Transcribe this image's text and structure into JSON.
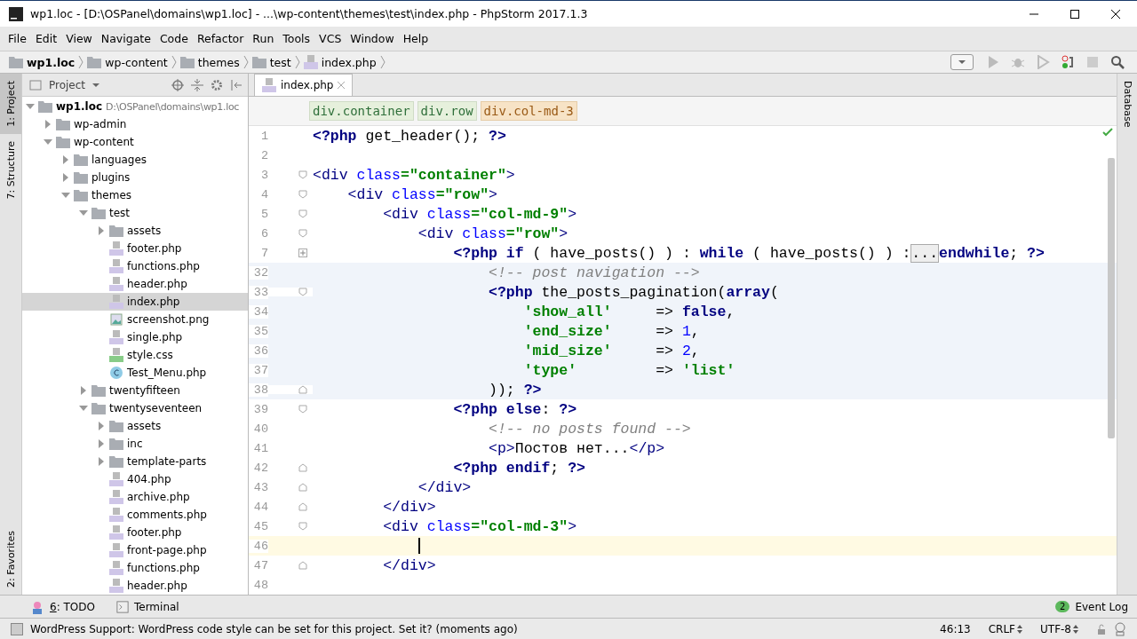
{
  "window": {
    "title": "wp1.loc - [D:\\OSPanel\\domains\\wp1.loc] - ...\\wp-content\\themes\\test\\index.php - PhpStorm 2017.1.3"
  },
  "menu": [
    "File",
    "Edit",
    "View",
    "Navigate",
    "Code",
    "Refactor",
    "Run",
    "Tools",
    "VCS",
    "Window",
    "Help"
  ],
  "nav_bar": [
    {
      "label": "wp1.loc",
      "kind": "root"
    },
    {
      "label": "wp-content",
      "kind": "folder"
    },
    {
      "label": "themes",
      "kind": "folder"
    },
    {
      "label": "test",
      "kind": "folder"
    },
    {
      "label": "index.php",
      "kind": "php"
    }
  ],
  "left_stripe": [
    {
      "label": "1: Project",
      "selected": true
    },
    {
      "label": "7: Structure",
      "selected": false
    },
    {
      "label": "2: Favorites",
      "selected": false
    }
  ],
  "right_stripe": [
    "Database"
  ],
  "project": {
    "title": "Project",
    "tree": [
      {
        "name": "wp1.loc",
        "path": "D:\\OSPanel\\domains\\wp1.loc",
        "kind": "folder",
        "expanded": true,
        "selected": false,
        "children": [
          {
            "name": "wp-admin",
            "kind": "folder",
            "expanded": false,
            "selected": false
          },
          {
            "name": "wp-content",
            "kind": "folder",
            "expanded": true,
            "selected": false,
            "children": [
              {
                "name": "languages",
                "kind": "folder",
                "expanded": false,
                "selected": false
              },
              {
                "name": "plugins",
                "kind": "folder",
                "expanded": false,
                "selected": false
              },
              {
                "name": "themes",
                "kind": "folder",
                "expanded": true,
                "selected": false,
                "children": [
                  {
                    "name": "test",
                    "kind": "folder",
                    "expanded": true,
                    "selected": false,
                    "children": [
                      {
                        "name": "assets",
                        "kind": "folder",
                        "expanded": false,
                        "selected": false
                      },
                      {
                        "name": "footer.php",
                        "kind": "php",
                        "selected": false
                      },
                      {
                        "name": "functions.php",
                        "kind": "php",
                        "selected": false
                      },
                      {
                        "name": "header.php",
                        "kind": "php",
                        "selected": false
                      },
                      {
                        "name": "index.php",
                        "kind": "php",
                        "selected": true
                      },
                      {
                        "name": "screenshot.png",
                        "kind": "image",
                        "selected": false
                      },
                      {
                        "name": "single.php",
                        "kind": "php",
                        "selected": false
                      },
                      {
                        "name": "style.css",
                        "kind": "css",
                        "selected": false
                      },
                      {
                        "name": "Test_Menu.php",
                        "kind": "class",
                        "selected": false
                      }
                    ]
                  },
                  {
                    "name": "twentyfifteen",
                    "kind": "folder",
                    "expanded": false,
                    "selected": false
                  },
                  {
                    "name": "twentyseventeen",
                    "kind": "folder",
                    "expanded": true,
                    "selected": false,
                    "children": [
                      {
                        "name": "assets",
                        "kind": "folder",
                        "expanded": false,
                        "selected": false
                      },
                      {
                        "name": "inc",
                        "kind": "folder",
                        "expanded": false,
                        "selected": false
                      },
                      {
                        "name": "template-parts",
                        "kind": "folder",
                        "expanded": false,
                        "selected": false
                      },
                      {
                        "name": "404.php",
                        "kind": "php",
                        "selected": false
                      },
                      {
                        "name": "archive.php",
                        "kind": "php",
                        "selected": false
                      },
                      {
                        "name": "comments.php",
                        "kind": "php",
                        "selected": false
                      },
                      {
                        "name": "footer.php",
                        "kind": "php",
                        "selected": false
                      },
                      {
                        "name": "front-page.php",
                        "kind": "php",
                        "selected": false
                      },
                      {
                        "name": "functions.php",
                        "kind": "php",
                        "selected": false
                      },
                      {
                        "name": "header.php",
                        "kind": "php",
                        "selected": false
                      }
                    ]
                  }
                ]
              }
            ]
          }
        ]
      }
    ]
  },
  "editor": {
    "tabs": [
      {
        "label": "index.php",
        "selected": true
      }
    ],
    "breadcrumbs": [
      {
        "label": "div.container",
        "selected": false
      },
      {
        "label": "div.row",
        "selected": false
      },
      {
        "label": "div.col-md-3",
        "selected": true
      }
    ],
    "lines": [
      {
        "number": "1",
        "shaded": false,
        "current": false,
        "tokens": [
          {
            "kind": "php",
            "t": "<?php"
          },
          {
            "kind": "plain",
            "t": " get_header(); "
          },
          {
            "kind": "php",
            "t": "?>"
          }
        ]
      },
      {
        "number": "2",
        "shaded": false,
        "current": false
      },
      {
        "number": "3",
        "fold": {
          "kind": "open"
        },
        "shaded": false,
        "current": false,
        "tokens": [
          {
            "kind": "tag",
            "t": "<div"
          },
          {
            "kind": "attr",
            "t": " class"
          },
          {
            "kind": "string",
            "t": "=\"container\""
          },
          {
            "kind": "tag",
            "t": ">"
          }
        ]
      },
      {
        "number": "4",
        "fold": {
          "kind": "open"
        },
        "shaded": false,
        "current": false,
        "tokens": [
          {
            "kind": "tag",
            "t": "    <div"
          },
          {
            "kind": "attr",
            "t": " class"
          },
          {
            "kind": "string",
            "t": "=\"row\""
          },
          {
            "kind": "tag",
            "t": ">"
          }
        ]
      },
      {
        "number": "5",
        "fold": {
          "kind": "open"
        },
        "shaded": false,
        "current": false,
        "tokens": [
          {
            "kind": "tag",
            "t": "        <div"
          },
          {
            "kind": "attr",
            "t": " class"
          },
          {
            "kind": "string",
            "t": "=\"col-md-9\""
          },
          {
            "kind": "tag",
            "t": ">"
          }
        ]
      },
      {
        "number": "6",
        "fold": {
          "kind": "open"
        },
        "shaded": false,
        "current": false,
        "tokens": [
          {
            "kind": "tag",
            "t": "            <div"
          },
          {
            "kind": "attr",
            "t": " class"
          },
          {
            "kind": "string",
            "t": "=\"row\""
          },
          {
            "kind": "tag",
            "t": ">"
          }
        ]
      },
      {
        "number": "7",
        "fold": {
          "kind": "collapsed"
        },
        "shaded": false,
        "current": false,
        "tokens": [
          {
            "kind": "php",
            "t": "                <?php"
          },
          {
            "kind": "keyword",
            "t": " if"
          },
          {
            "kind": "plain",
            "t": " ( have_posts() ) : "
          },
          {
            "kind": "keyword",
            "t": "while"
          },
          {
            "kind": "plain",
            "t": " ( have_posts() ) :"
          },
          {
            "kind": "fold",
            "t": "..."
          },
          {
            "kind": "keyword",
            "t": "endwhile"
          },
          {
            "kind": "plain",
            "t": "; "
          },
          {
            "kind": "php",
            "t": "?>"
          }
        ]
      },
      {
        "number": "32",
        "shaded": true,
        "current": false,
        "tokens": [
          {
            "kind": "comment",
            "t": "                    <!-- post navigation -->"
          }
        ]
      },
      {
        "number": "33",
        "fold": {
          "kind": "open"
        },
        "shaded": true,
        "current": false,
        "tokens": [
          {
            "kind": "php",
            "t": "                    <?php"
          },
          {
            "kind": "plain",
            "t": " the_posts_pagination("
          },
          {
            "kind": "keyword",
            "t": "array"
          },
          {
            "kind": "plain",
            "t": "("
          }
        ]
      },
      {
        "number": "34",
        "shaded": true,
        "current": false,
        "tokens": [
          {
            "kind": "string",
            "t": "                        'show_all'"
          },
          {
            "kind": "plain",
            "t": "     => "
          },
          {
            "kind": "keyword",
            "t": "false"
          },
          {
            "kind": "plain",
            "t": ","
          }
        ]
      },
      {
        "number": "35",
        "shaded": true,
        "current": false,
        "tokens": [
          {
            "kind": "string",
            "t": "                        'end_size'"
          },
          {
            "kind": "plain",
            "t": "     => "
          },
          {
            "kind": "number",
            "t": "1"
          },
          {
            "kind": "plain",
            "t": ","
          }
        ]
      },
      {
        "number": "36",
        "shaded": true,
        "current": false,
        "tokens": [
          {
            "kind": "string",
            "t": "                        'mid_size'"
          },
          {
            "kind": "plain",
            "t": "     => "
          },
          {
            "kind": "number",
            "t": "2"
          },
          {
            "kind": "plain",
            "t": ","
          }
        ]
      },
      {
        "number": "37",
        "shaded": true,
        "current": false,
        "tokens": [
          {
            "kind": "string",
            "t": "                        'type'"
          },
          {
            "kind": "plain",
            "t": "         => "
          },
          {
            "kind": "string",
            "t": "'list'"
          }
        ]
      },
      {
        "number": "38",
        "fold": {
          "kind": "close"
        },
        "shaded": true,
        "current": false,
        "tokens": [
          {
            "kind": "plain",
            "t": "                    )); "
          },
          {
            "kind": "php",
            "t": "?>"
          }
        ]
      },
      {
        "number": "39",
        "fold": {
          "kind": "open"
        },
        "shaded": false,
        "current": false,
        "tokens": [
          {
            "kind": "php",
            "t": "                <?php"
          },
          {
            "kind": "keyword",
            "t": " else"
          },
          {
            "kind": "plain",
            "t": ": "
          },
          {
            "kind": "php",
            "t": "?>"
          }
        ]
      },
      {
        "number": "40",
        "shaded": false,
        "current": false,
        "tokens": [
          {
            "kind": "comment",
            "t": "                    <!-- no posts found -->"
          }
        ]
      },
      {
        "number": "41",
        "shaded": false,
        "current": false,
        "tokens": [
          {
            "kind": "tag",
            "t": "                    <p>"
          },
          {
            "kind": "plain",
            "t": "Постов нет..."
          },
          {
            "kind": "tag",
            "t": "</p>"
          }
        ]
      },
      {
        "number": "42",
        "fold": {
          "kind": "close"
        },
        "shaded": false,
        "current": false,
        "tokens": [
          {
            "kind": "php",
            "t": "                <?php"
          },
          {
            "kind": "keyword",
            "t": " endif"
          },
          {
            "kind": "plain",
            "t": "; "
          },
          {
            "kind": "php",
            "t": "?>"
          }
        ]
      },
      {
        "number": "43",
        "fold": {
          "kind": "close"
        },
        "shaded": false,
        "current": false,
        "tokens": [
          {
            "kind": "tag",
            "t": "            </div>"
          }
        ]
      },
      {
        "number": "44",
        "fold": {
          "kind": "close"
        },
        "shaded": false,
        "current": false,
        "tokens": [
          {
            "kind": "tag",
            "t": "        </div>"
          }
        ]
      },
      {
        "number": "45",
        "fold": {
          "kind": "open"
        },
        "shaded": false,
        "current": false,
        "tokens": [
          {
            "kind": "tag",
            "t": "        <div"
          },
          {
            "kind": "attr",
            "t": " class"
          },
          {
            "kind": "string",
            "t": "=\"col-md-3\""
          },
          {
            "kind": "tag",
            "t": ">"
          }
        ]
      },
      {
        "number": "46",
        "shaded": false,
        "current": true
      },
      {
        "number": "47",
        "fold": {
          "kind": "close"
        },
        "shaded": false,
        "current": false,
        "tokens": [
          {
            "kind": "tag",
            "t": "        </div>"
          }
        ]
      },
      {
        "number": "48",
        "shaded": false,
        "current": false
      }
    ]
  },
  "tool_windows": [
    {
      "number": "6",
      "label": ": TODO",
      "kind": "todo"
    },
    {
      "label": "Terminal",
      "kind": "terminal"
    }
  ],
  "event_log": {
    "count": "2",
    "label": "Event Log"
  },
  "status_bar": {
    "message": "WordPress Support: WordPress code style can be set for this project. Set it? (moments ago)",
    "position": "46:13",
    "line_separator": "CRLF",
    "encoding": "UTF-8"
  }
}
